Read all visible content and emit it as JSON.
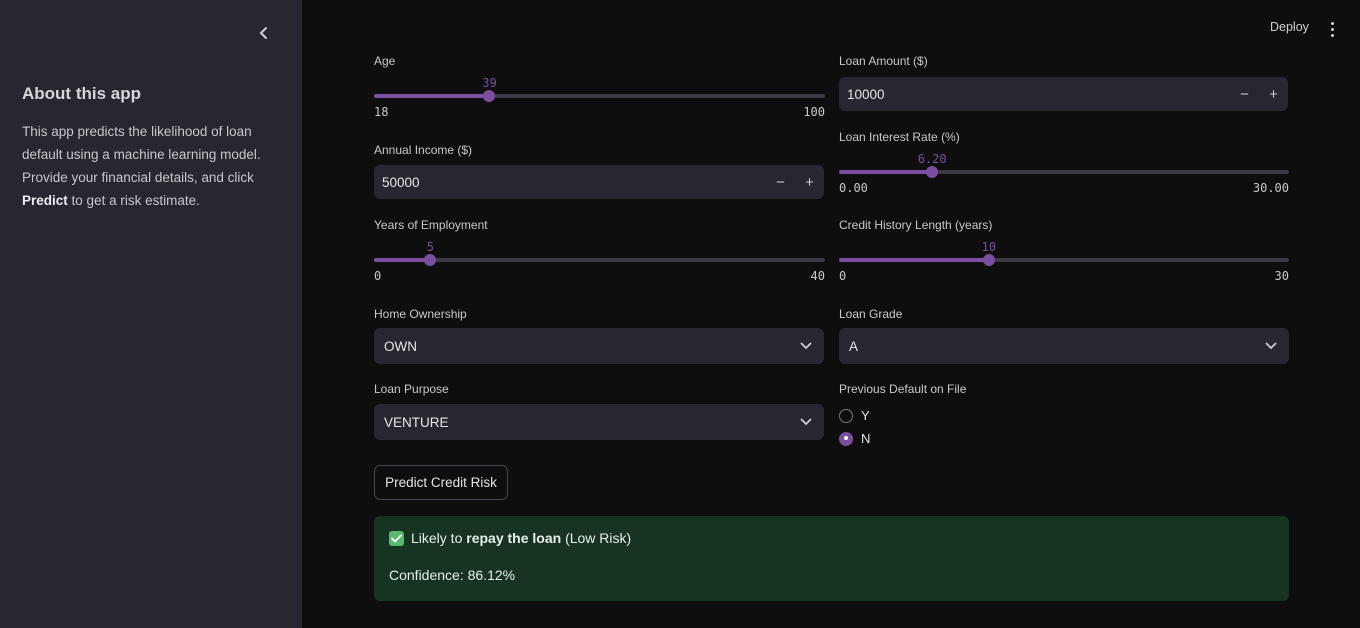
{
  "sidebar": {
    "title": "About this app",
    "text_a": "This app predicts the likelihood of loan default using a machine learning model. Provide your financial details, and click",
    "text_bold": "Predict",
    "text_b": "to get a risk estimate."
  },
  "header": {
    "deploy_label": "Deploy"
  },
  "form": {
    "age": {
      "label": "Age",
      "value": "39",
      "min": "18",
      "max": "100",
      "fraction": 0.256
    },
    "loan_amount": {
      "label": "Loan Amount ($)",
      "value": "10000"
    },
    "annual_income": {
      "label": "Annual Income ($)",
      "value": "50000"
    },
    "interest_rate": {
      "label": "Loan Interest Rate (%)",
      "value": "6.20",
      "min": "0.00",
      "max": "30.00",
      "fraction": 0.207
    },
    "employment": {
      "label": "Years of Employment",
      "value": "5",
      "min": "0",
      "max": "40",
      "fraction": 0.125
    },
    "credit_history": {
      "label": "Credit History Length (years)",
      "value": "10",
      "min": "0",
      "max": "30",
      "fraction": 0.333
    },
    "home_ownership": {
      "label": "Home Ownership",
      "value": "OWN"
    },
    "loan_grade": {
      "label": "Loan Grade",
      "value": "A"
    },
    "loan_purpose": {
      "label": "Loan Purpose",
      "value": "VENTURE"
    },
    "previous_default": {
      "label": "Previous Default on File",
      "options": [
        "Y",
        "N"
      ],
      "selected": "N"
    },
    "minus": "−",
    "plus": "+"
  },
  "predict_button": "Predict Credit Risk",
  "result": {
    "prefix": "Likely to",
    "bold": "repay the loan",
    "suffix": "(Low Risk)",
    "confidence": "Confidence: 86.12%"
  },
  "colors": {
    "accent": "#7a4fa0",
    "sidebar_bg": "#262730",
    "success_bg": "#173422",
    "check_green": "#58b870"
  },
  "icons": {
    "collapse": "chevron-left-icon",
    "menu": "kebab-menu-icon",
    "select": "chevron-down-icon",
    "check": "checkmark-icon"
  }
}
